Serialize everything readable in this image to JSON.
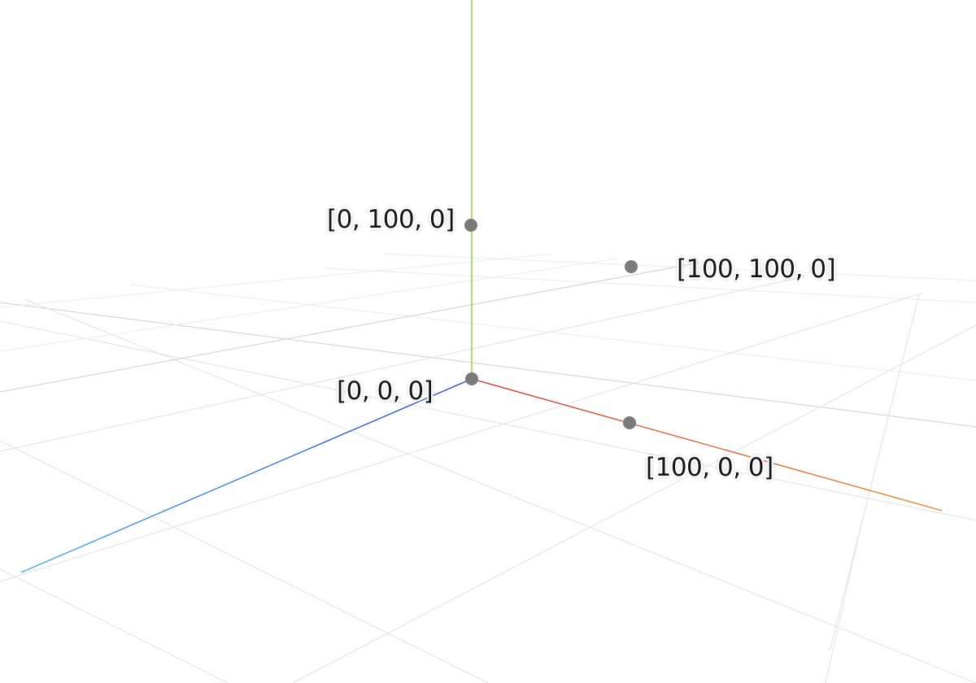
{
  "scene": {
    "background": "#ffffff",
    "grid_color": "#e2e2e2",
    "axes": {
      "x": {
        "colors": [
          "#d42a1e",
          "#e8832a"
        ],
        "direction": "positive-x"
      },
      "y": {
        "color": "#7ed321",
        "direction": "positive-y"
      },
      "z": {
        "colors": [
          "#1c3bd0",
          "#3ea8e8"
        ],
        "direction": "positive-z"
      }
    },
    "point_color": "#7a7a7a",
    "points": [
      {
        "id": "origin",
        "label": "[0, 0, 0]"
      },
      {
        "id": "y100",
        "label": "[0, 100, 0]"
      },
      {
        "id": "x100",
        "label": "[100, 0, 0]"
      },
      {
        "id": "xy100",
        "label": "[100, 100, 0]"
      }
    ]
  }
}
